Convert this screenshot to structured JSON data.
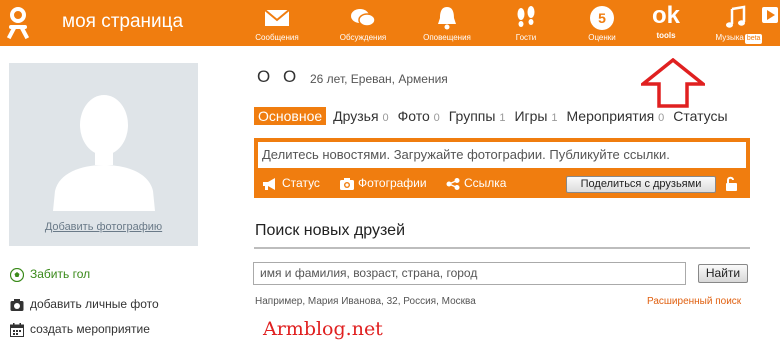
{
  "header": {
    "site_title": "моя страница",
    "nav": [
      {
        "label": "Сообщения",
        "icon": "envelope-icon"
      },
      {
        "label": "Обсуждения",
        "icon": "chat-bubbles-icon"
      },
      {
        "label": "Оповещения",
        "icon": "bell-icon"
      },
      {
        "label": "Гости",
        "icon": "footprints-icon"
      },
      {
        "label": "Оценки",
        "icon": "rating-five-icon",
        "value": "5"
      },
      {
        "label": "tools",
        "icon": "ok-logo-text",
        "value": "ok"
      },
      {
        "label": "Музыка",
        "icon": "music-note-icon",
        "badge": "beta"
      }
    ]
  },
  "profile": {
    "name_symbols": "О О",
    "info": "26 лет, Ереван, Армения",
    "add_photo": "Добавить фотографию"
  },
  "sidebar": {
    "links": [
      {
        "label": "Забить гол",
        "icon": "football-icon"
      },
      {
        "label": "добавить личные фото",
        "icon": "camera-icon"
      },
      {
        "label": "создать мероприятие",
        "icon": "calendar-icon"
      }
    ]
  },
  "tabs": [
    {
      "label": "Основное",
      "count": ""
    },
    {
      "label": "Друзья",
      "count": "0"
    },
    {
      "label": "Фото",
      "count": "0"
    },
    {
      "label": "Группы",
      "count": "1"
    },
    {
      "label": "Игры",
      "count": "1"
    },
    {
      "label": "Мероприятия",
      "count": "0"
    },
    {
      "label": "Статусы",
      "count": ""
    }
  ],
  "share": {
    "placeholder": "Делитесь новостями. Загружайте фотографии. Публикуйте ссылки.",
    "status": "Статус",
    "photos": "Фотографии",
    "link": "Ссылка",
    "button": "Поделиться с друзьями"
  },
  "search": {
    "title": "Поиск новых друзей",
    "placeholder": "имя и фамилия, возраст, страна, город",
    "button": "Найти",
    "example": "Например, Мария Иванова, 32, Россия, Москва",
    "advanced": "Расширенный поиск"
  },
  "watermark": "Armblog.net",
  "colors": {
    "accent": "#f07d0f",
    "arrow": "#e02020",
    "link_orange": "#e06010"
  }
}
